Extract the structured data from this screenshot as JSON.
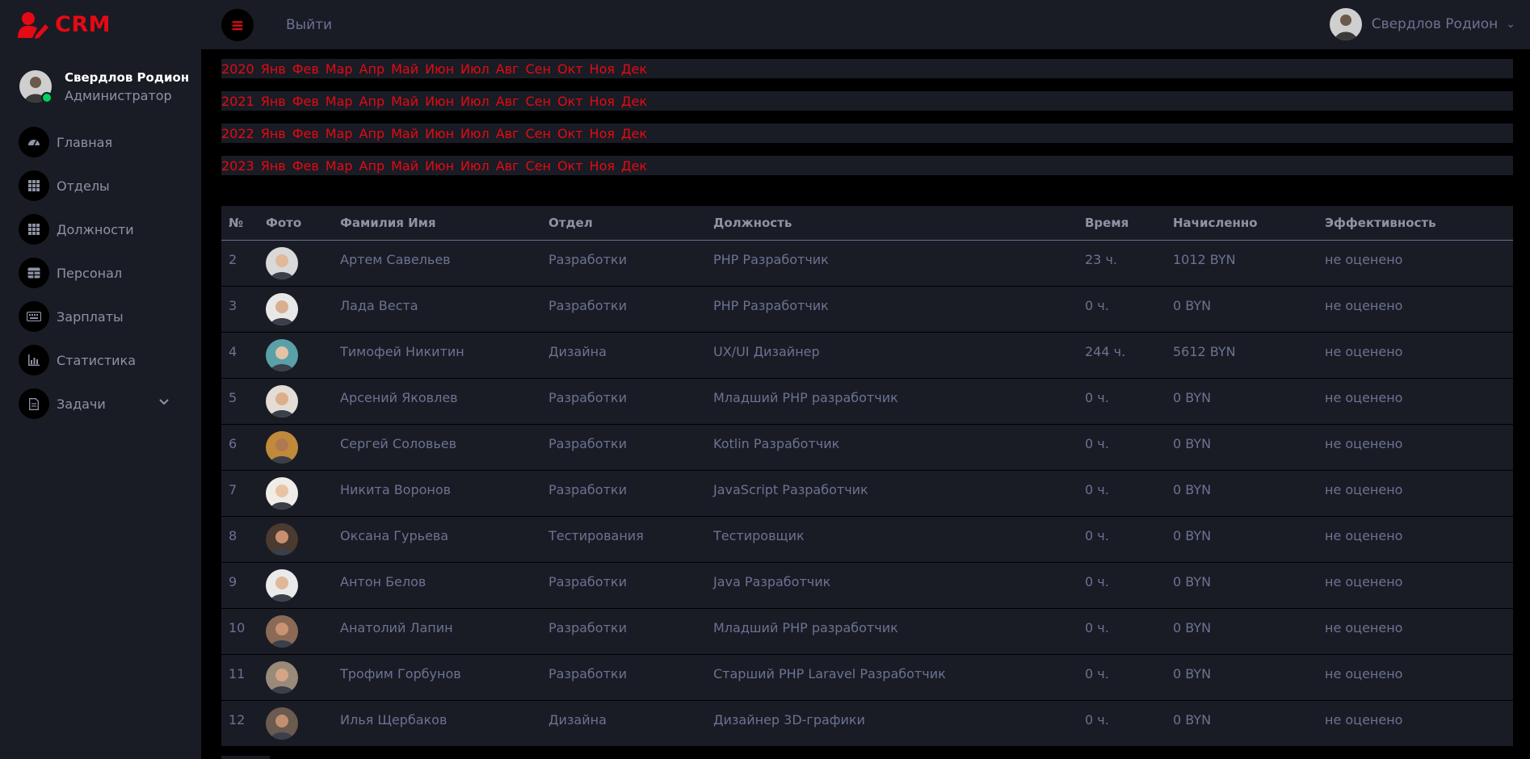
{
  "brand": {
    "name": "CRM",
    "color": "#e50914"
  },
  "topbar": {
    "logout": "Выйти",
    "user_name": "Свердлов Родион"
  },
  "sidebar": {
    "profile": {
      "name": "Свердлов Родион",
      "role": "Администратор"
    },
    "items": [
      {
        "label": "Главная",
        "icon": "speedometer-icon"
      },
      {
        "label": "Отделы",
        "icon": "grid-icon"
      },
      {
        "label": "Должности",
        "icon": "grid-icon"
      },
      {
        "label": "Персонал",
        "icon": "table-icon"
      },
      {
        "label": "Зарплаты",
        "icon": "keyboard-icon"
      },
      {
        "label": "Статистика",
        "icon": "chart-icon"
      },
      {
        "label": "Задачи",
        "icon": "document-icon"
      }
    ]
  },
  "calendar": {
    "months": [
      "Янв",
      "Фев",
      "Мар",
      "Апр",
      "Май",
      "Июн",
      "Июл",
      "Авг",
      "Сен",
      "Окт",
      "Ноя",
      "Дек"
    ],
    "years": [
      "2020",
      "2021",
      "2022",
      "2023"
    ]
  },
  "table": {
    "headers": [
      "№",
      "Фото",
      "Фамилия Имя",
      "Отдел",
      "Должность",
      "Время",
      "Начисленно",
      "Эффективность"
    ],
    "rows": [
      {
        "num": "2",
        "name": "Артем Савельев",
        "dept": "Разработки",
        "position": "PHP Разработчик",
        "time": "23 ч.",
        "salary": "1012 BYN",
        "eff": "не оценено"
      },
      {
        "num": "3",
        "name": "Лада Веста",
        "dept": "Разработки",
        "position": "PHP Разработчик",
        "time": "0 ч.",
        "salary": "0 BYN",
        "eff": "не оценено"
      },
      {
        "num": "4",
        "name": "Тимофей Никитин",
        "dept": "Дизайна",
        "position": "UX/UI Дизайнер",
        "time": "244 ч.",
        "salary": "5612 BYN",
        "eff": "не оценено"
      },
      {
        "num": "5",
        "name": "Арсений Яковлев",
        "dept": "Разработки",
        "position": "Младший PHP разработчик",
        "time": "0 ч.",
        "salary": "0 BYN",
        "eff": "не оценено"
      },
      {
        "num": "6",
        "name": "Сергей Соловьев",
        "dept": "Разработки",
        "position": "Kotlin Разработчик",
        "time": "0 ч.",
        "salary": "0 BYN",
        "eff": "не оценено"
      },
      {
        "num": "7",
        "name": "Никита Воронов",
        "dept": "Разработки",
        "position": "JavaScript Разработчик",
        "time": "0 ч.",
        "salary": "0 BYN",
        "eff": "не оценено"
      },
      {
        "num": "8",
        "name": "Оксана Гурьева",
        "dept": "Тестирования",
        "position": "Тестировщик",
        "time": "0 ч.",
        "salary": "0 BYN",
        "eff": "не оценено"
      },
      {
        "num": "9",
        "name": "Антон Белов",
        "dept": "Разработки",
        "position": "Java Разработчик",
        "time": "0 ч.",
        "salary": "0 BYN",
        "eff": "не оценено"
      },
      {
        "num": "10",
        "name": "Анатолий Лапин",
        "dept": "Разработки",
        "position": "Младший PHP разработчик",
        "time": "0 ч.",
        "salary": "0 BYN",
        "eff": "не оценено"
      },
      {
        "num": "11",
        "name": "Трофим Горбунов",
        "dept": "Разработки",
        "position": "Старший PHP Laravel Разработчик",
        "time": "0 ч.",
        "salary": "0 BYN",
        "eff": "не оценено"
      },
      {
        "num": "12",
        "name": "Илья Щербаков",
        "dept": "Дизайна",
        "position": "Дизайнер 3D-графики",
        "time": "0 ч.",
        "salary": "0 BYN",
        "eff": "не оценено"
      }
    ]
  }
}
